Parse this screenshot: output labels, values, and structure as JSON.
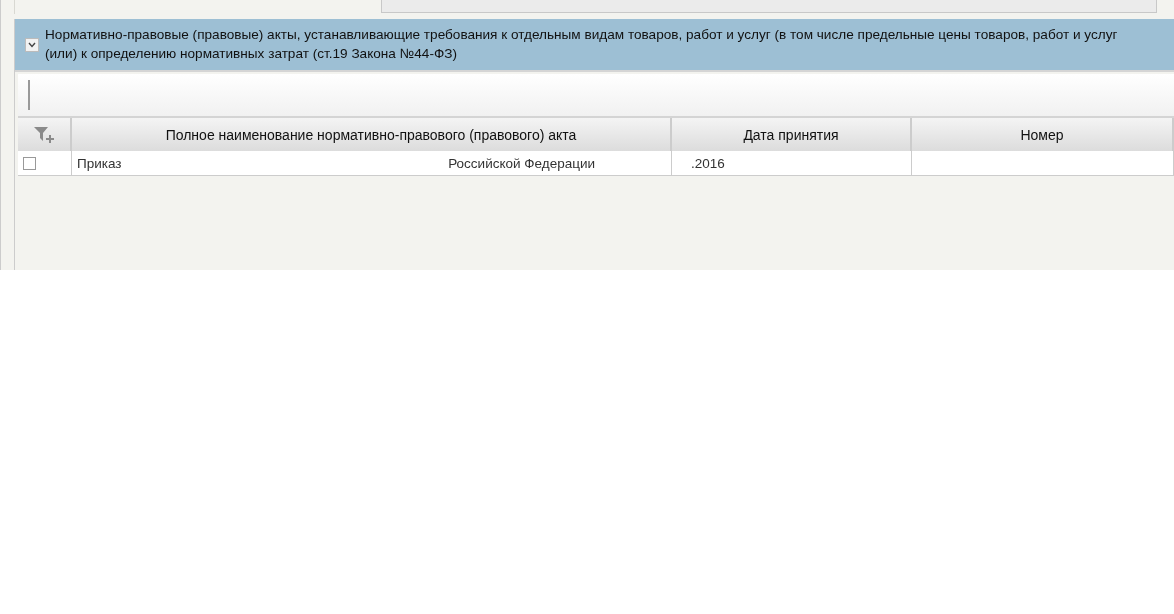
{
  "section": {
    "title_lines": [
      "Нормативно-правовые (правовые) акты, устанавливающие требования к отдельным видам товаров, работ и услуг (в том числе предельные цены товаров, работ и услуг",
      "(или) к определению нормативных затрат (ст.19 Закона №44-ФЗ)"
    ],
    "expanded": true
  },
  "table": {
    "columns": [
      "Полное наименование нормативно-правового (правового) акта",
      "Дата принятия",
      "Номер"
    ],
    "rows": [
      {
        "checked": false,
        "name_start": "Приказ",
        "name_end": "Российской Федерации",
        "date": ".2016"
      }
    ]
  }
}
